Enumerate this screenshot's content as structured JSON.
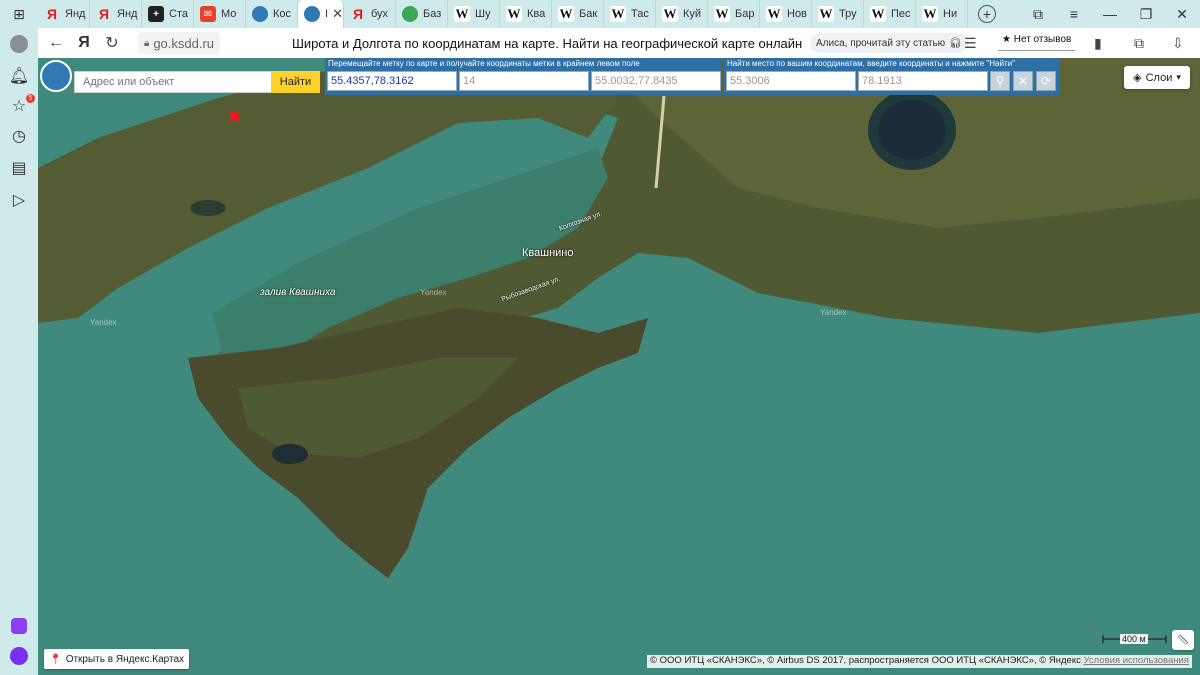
{
  "browser": {
    "tabs": [
      {
        "label": "Янд",
        "favicon": "yandex-favicon"
      },
      {
        "label": "Янд",
        "favicon": "yandex-favicon"
      },
      {
        "label": "Ста",
        "favicon": "plus-favicon"
      },
      {
        "label": "Мо",
        "favicon": "mail-favicon"
      },
      {
        "label": "Кос",
        "favicon": "compass-favicon"
      },
      {
        "label": "I",
        "favicon": "compass-favicon",
        "active": true
      },
      {
        "label": "бух",
        "favicon": "yandex-favicon"
      },
      {
        "label": "Баз",
        "favicon": "green-favicon"
      },
      {
        "label": "Шу",
        "favicon": "wikipedia-favicon"
      },
      {
        "label": "Ква",
        "favicon": "wikipedia-favicon"
      },
      {
        "label": "Бак",
        "favicon": "wikipedia-favicon"
      },
      {
        "label": "Тас",
        "favicon": "wikipedia-favicon"
      },
      {
        "label": "Куй",
        "favicon": "wikipedia-favicon"
      },
      {
        "label": "Бар",
        "favicon": "wikipedia-favicon"
      },
      {
        "label": "Нов",
        "favicon": "wikipedia-favicon"
      },
      {
        "label": "Тру",
        "favicon": "wikipedia-favicon"
      },
      {
        "label": "Пес",
        "favicon": "wikipedia-favicon"
      },
      {
        "label": "Ни",
        "favicon": "wikipedia-favicon"
      }
    ],
    "url": "go.ksdd.ru",
    "page_title": "Широта и Долгота по координатам на карте. Найти на географической карте онлайн",
    "alice_label": "Алиса, прочитай эту статью",
    "reviews_label": "★ Нет отзывов",
    "notification_count": "5"
  },
  "map_page": {
    "search_placeholder": "Адрес или объект",
    "search_button": "Найти",
    "panel1_caption": "Перемещайте метку по карте и получайте координаты метки в крайнем левом поле",
    "coords_value": "55.4357,78.3162",
    "zoom_value": "14",
    "corner_coords_value": "55.0032,77.8435",
    "panel2_caption": "Найти место по вашим координатам, введите координаты и нажмите \"Найти\"",
    "lat_value": "55.3006",
    "lon_value": "78.1913",
    "layers_label": "Слои",
    "labels": {
      "town": "Квашнино",
      "bay": "залив Квашниха",
      "street1": "Колхозная ул.",
      "street2": "Рыбозаводская ул.",
      "watermark": "Yandex"
    },
    "open_in_maps": "Открыть в Яндекс.Картах",
    "scale_label": "400 м",
    "copyright": "© ООО ИТЦ «СКАНЭКС», © Airbus DS 2017, распространяется ООО ИТЦ «СКАНЭКС», © Яндекс",
    "terms_link": "Условия использования"
  },
  "colors": {
    "water": "#3d8577",
    "land": "#4a5530",
    "panel": "#2e6fa6",
    "search_button": "#ffd22b"
  }
}
